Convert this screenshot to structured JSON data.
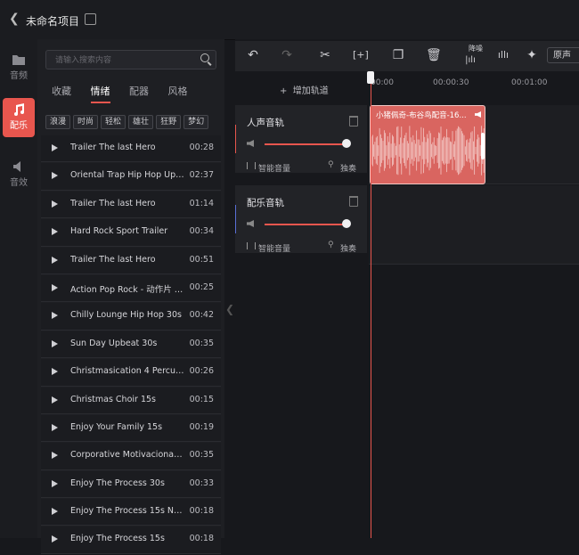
{
  "project": {
    "title": "未命名项目"
  },
  "rail": {
    "items": [
      {
        "label": "音频",
        "icon": "folder-icon"
      },
      {
        "label": "配乐",
        "icon": "music-note-icon",
        "active": true
      },
      {
        "label": "音效",
        "icon": "speaker-icon"
      }
    ]
  },
  "library": {
    "search_placeholder": "请输入搜索内容",
    "tabs": [
      "收藏",
      "情绪",
      "配器",
      "风格"
    ],
    "active_tab": 1,
    "tags": [
      "浪漫",
      "时尚",
      "轻松",
      "雄壮",
      "狂野",
      "梦幻"
    ],
    "tracks": [
      {
        "name": "Trailer The last Hero",
        "duration": "00:28"
      },
      {
        "name": "Oriental Trap Hip Hop Upb...",
        "duration": "02:37"
      },
      {
        "name": "Trailer The last Hero",
        "duration": "01:14"
      },
      {
        "name": "Hard Rock Sport Trailer",
        "duration": "00:34"
      },
      {
        "name": "Trailer The last Hero",
        "duration": "00:51"
      },
      {
        "name": "Action Pop Rock - 动作片 l...",
        "duration": "00:25"
      },
      {
        "name": "Chilly Lounge Hip Hop 30s",
        "duration": "00:42"
      },
      {
        "name": "Sun Day Upbeat 30s",
        "duration": "00:35"
      },
      {
        "name": "Christmasication 4 Percussi...",
        "duration": "00:26"
      },
      {
        "name": "Christmas Choir 15s",
        "duration": "00:15"
      },
      {
        "name": "Enjoy Your Family 15s",
        "duration": "00:19"
      },
      {
        "name": "Corporative Motivacional 3...",
        "duration": "00:35"
      },
      {
        "name": "Enjoy The Process 30s",
        "duration": "00:33"
      },
      {
        "name": "Enjoy The Process 15s No ...",
        "duration": "00:18"
      },
      {
        "name": "Enjoy The Process 15s",
        "duration": "00:18"
      }
    ]
  },
  "toolbar": {
    "reduce_noise_label": "降噪",
    "voice_dropdown": "原声"
  },
  "timeline": {
    "add_track_label": "增加轨道",
    "ticks": [
      "00:00",
      "00:00:30",
      "00:01:00"
    ],
    "tracks": [
      {
        "title": "人声音轨",
        "smart_volume": "智能音量",
        "solo": "独奏",
        "volume": 1.0
      },
      {
        "title": "配乐音轨",
        "smart_volume": "智能音量",
        "solo": "独奏",
        "volume": 1.0
      }
    ],
    "clip": {
      "title": "小猪佩奇-布谷鸟配音-16..."
    }
  },
  "colors": {
    "accent": "#e8564e",
    "clip": "#d96560",
    "background": "#17181c"
  }
}
